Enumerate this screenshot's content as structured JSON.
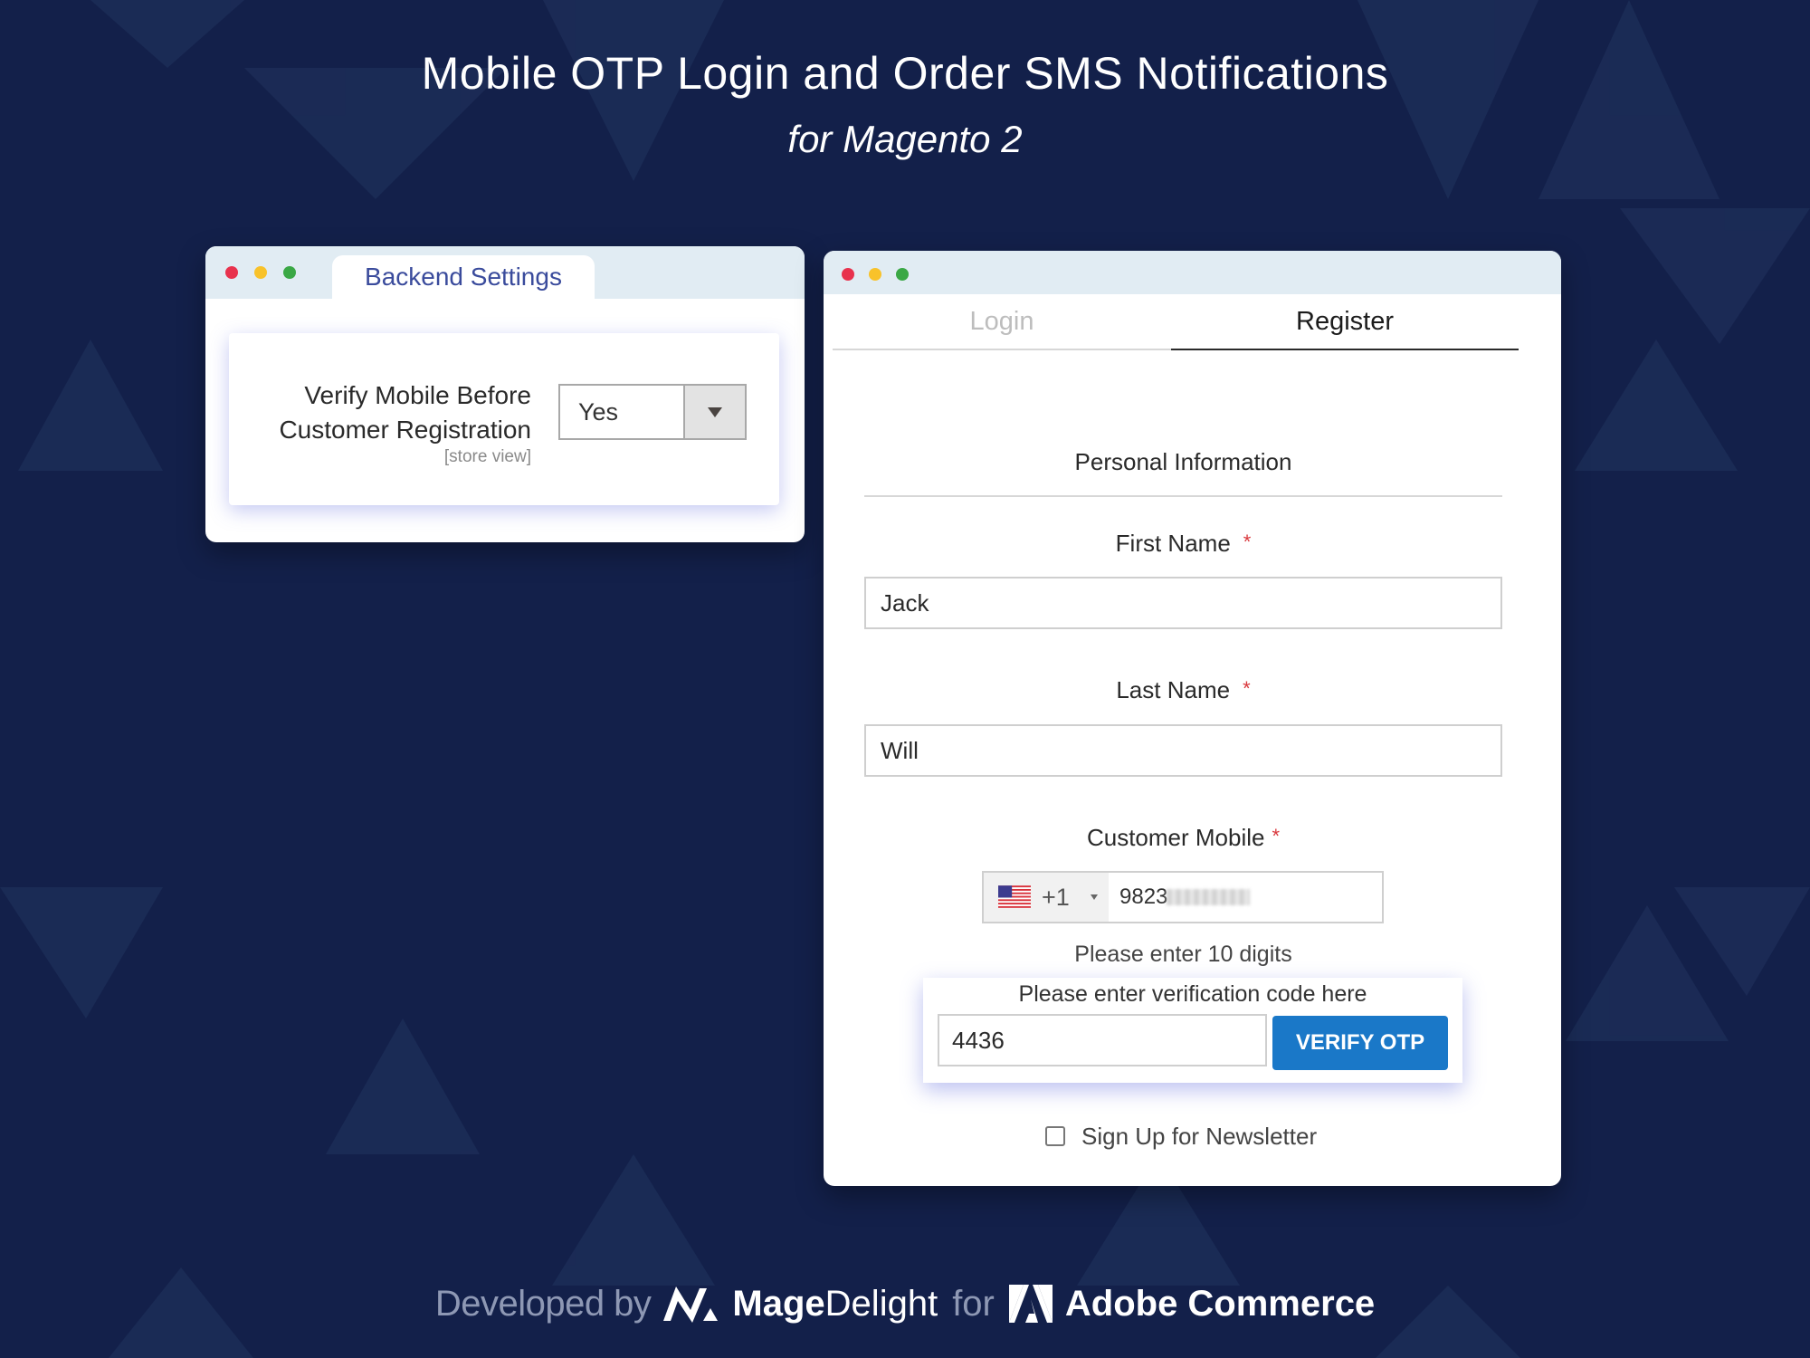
{
  "header": {
    "title": "Mobile OTP Login and Order SMS Notifications",
    "subtitle": "for Magento 2"
  },
  "backend_window": {
    "tab_label": "Backend Settings",
    "setting": {
      "label_line1": "Verify Mobile Before",
      "label_line2": "Customer Registration",
      "scope": "[store view]",
      "selected_value": "Yes"
    }
  },
  "register_window": {
    "tabs": [
      {
        "label": "Login",
        "active": false
      },
      {
        "label": "Register",
        "active": true
      }
    ],
    "section_title": "Personal Information",
    "required_marker": "*",
    "fields": {
      "first_name": {
        "label": "First Name",
        "value": "Jack"
      },
      "last_name": {
        "label": "Last Name",
        "value": "Will"
      },
      "mobile": {
        "label": "Customer Mobile",
        "country_flag": "us-flag-icon",
        "dial_code": "+1",
        "value_visible": "9823",
        "hint": "Please enter 10 digits"
      }
    },
    "otp": {
      "label": "Please enter verification code here",
      "value": "4436",
      "button_label": "VERIFY OTP"
    },
    "newsletter": {
      "label": "Sign Up for Newsletter",
      "checked": false
    }
  },
  "footer": {
    "developed_by": "Developed by",
    "brand_bold": "Mage",
    "brand_light": "Delight",
    "for_word": "for",
    "platform": "Adobe Commerce"
  },
  "colors": {
    "background": "#13204a",
    "accent_button": "#1a78c8",
    "tab_text": "#3a4b9c",
    "required": "#d9383d"
  }
}
